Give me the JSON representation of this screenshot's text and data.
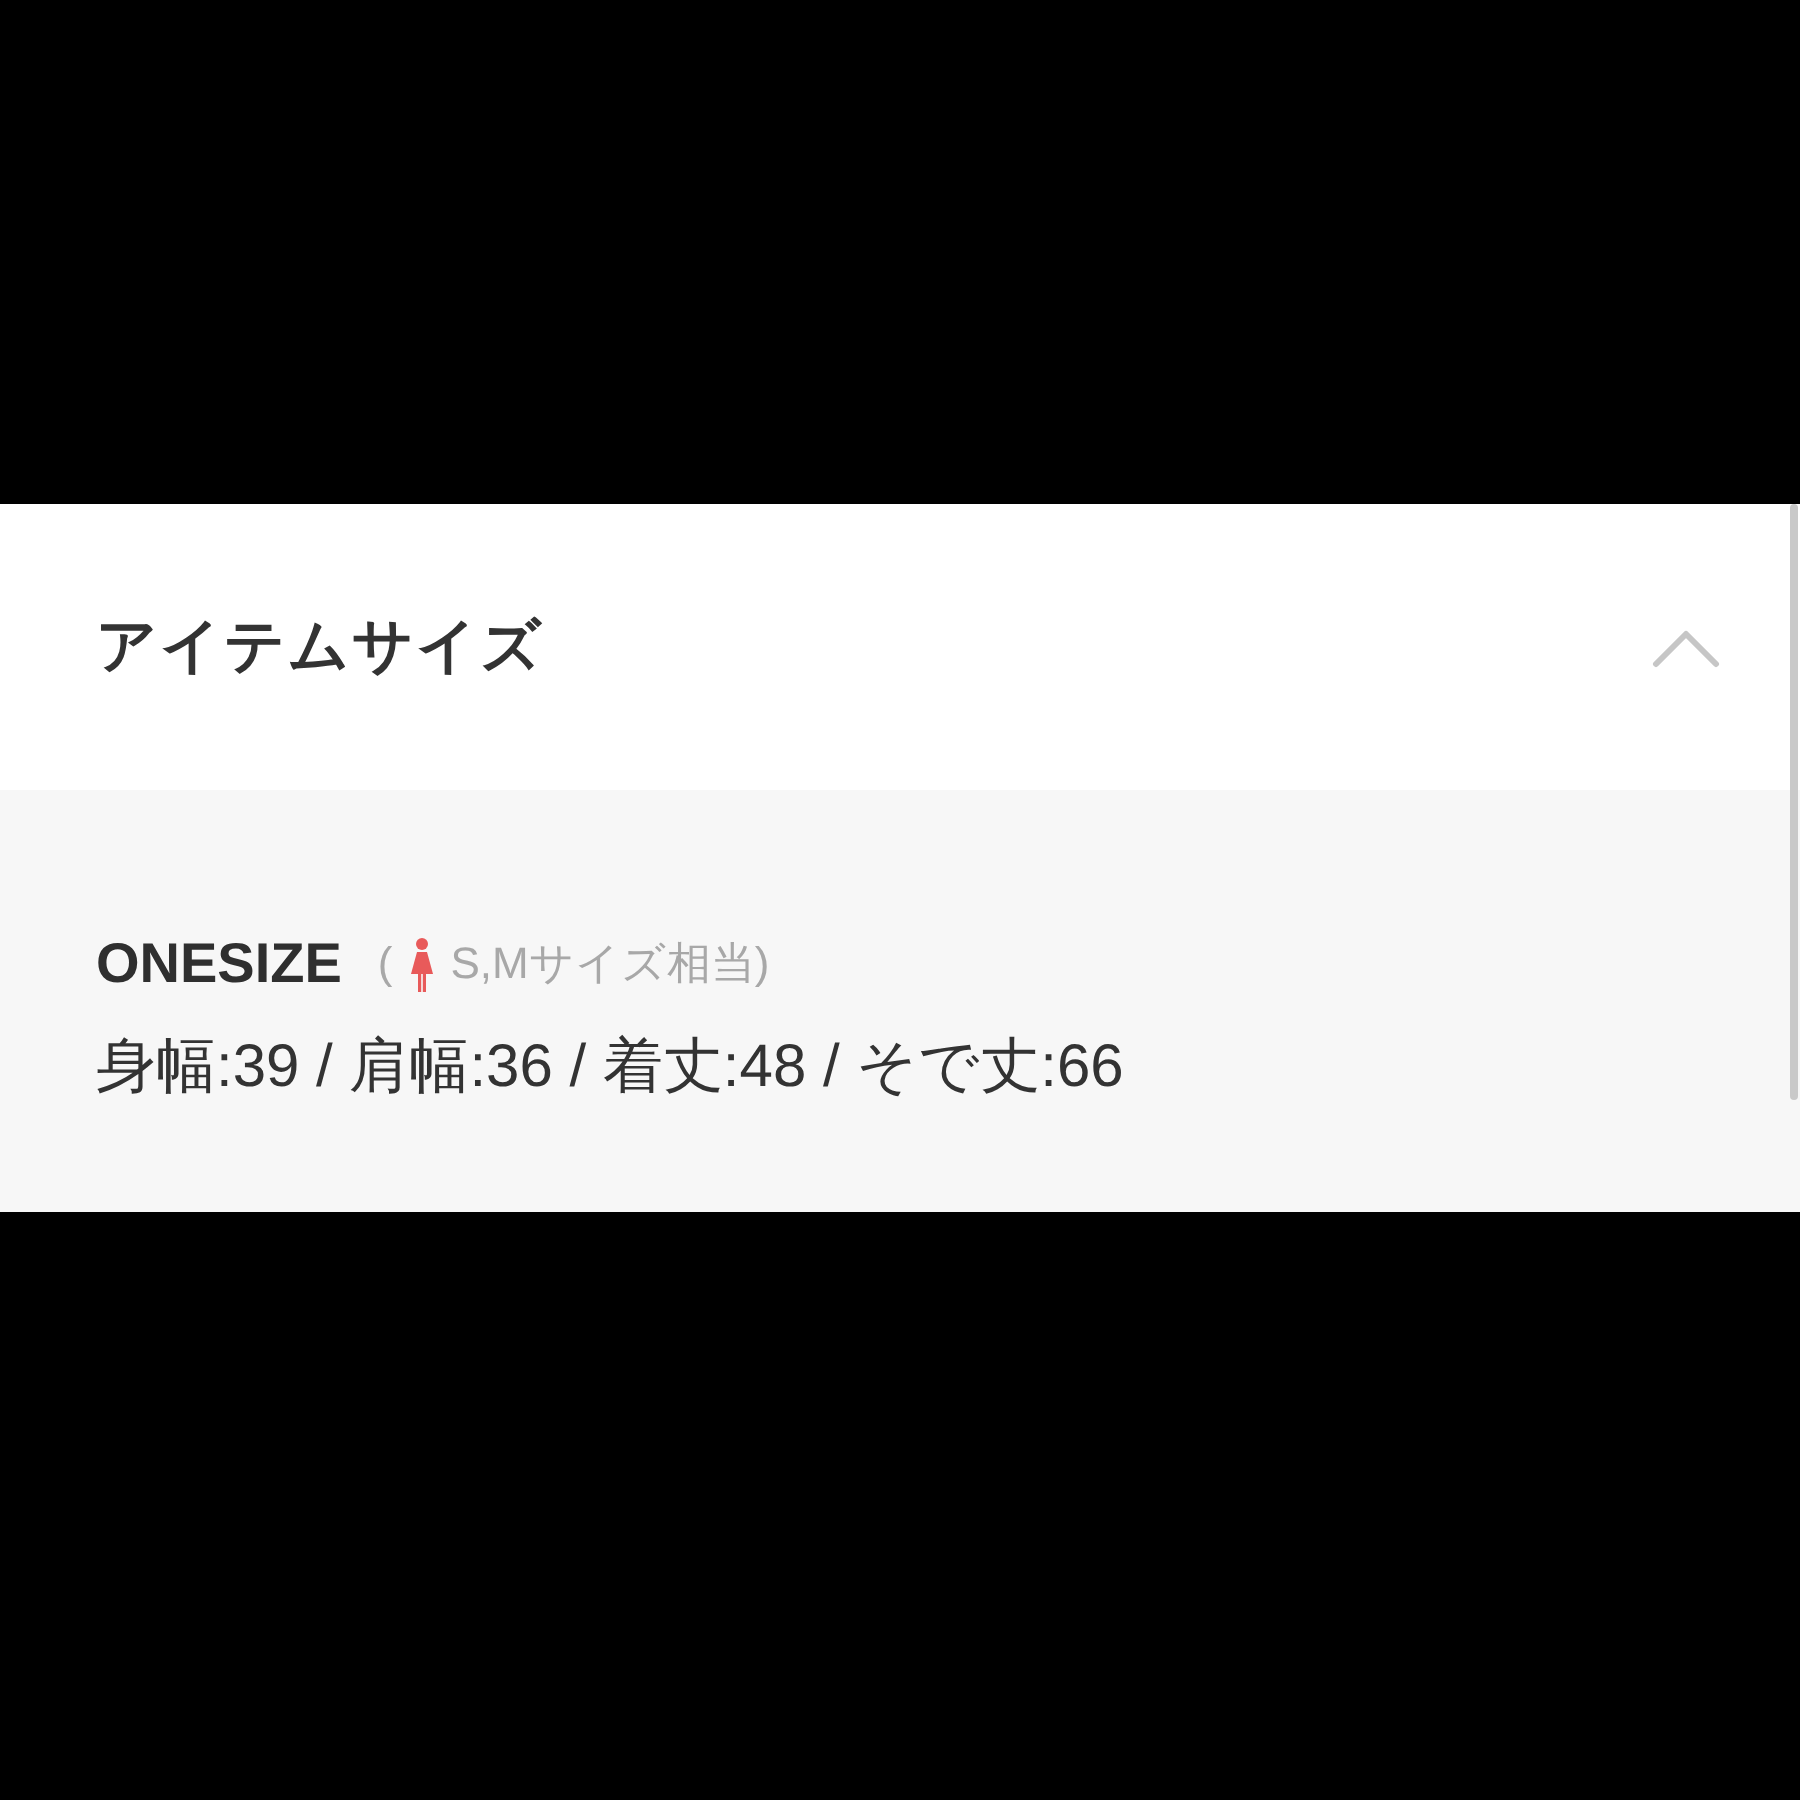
{
  "section": {
    "title": "アイテムサイズ",
    "expanded": true
  },
  "sizes": [
    {
      "name": "ONESIZE",
      "note_open": "(",
      "note": "S,Mサイズ相当)",
      "measurements": "身幅:39 / 肩幅:36 / 着丈:48 / そで丈:66"
    }
  ]
}
